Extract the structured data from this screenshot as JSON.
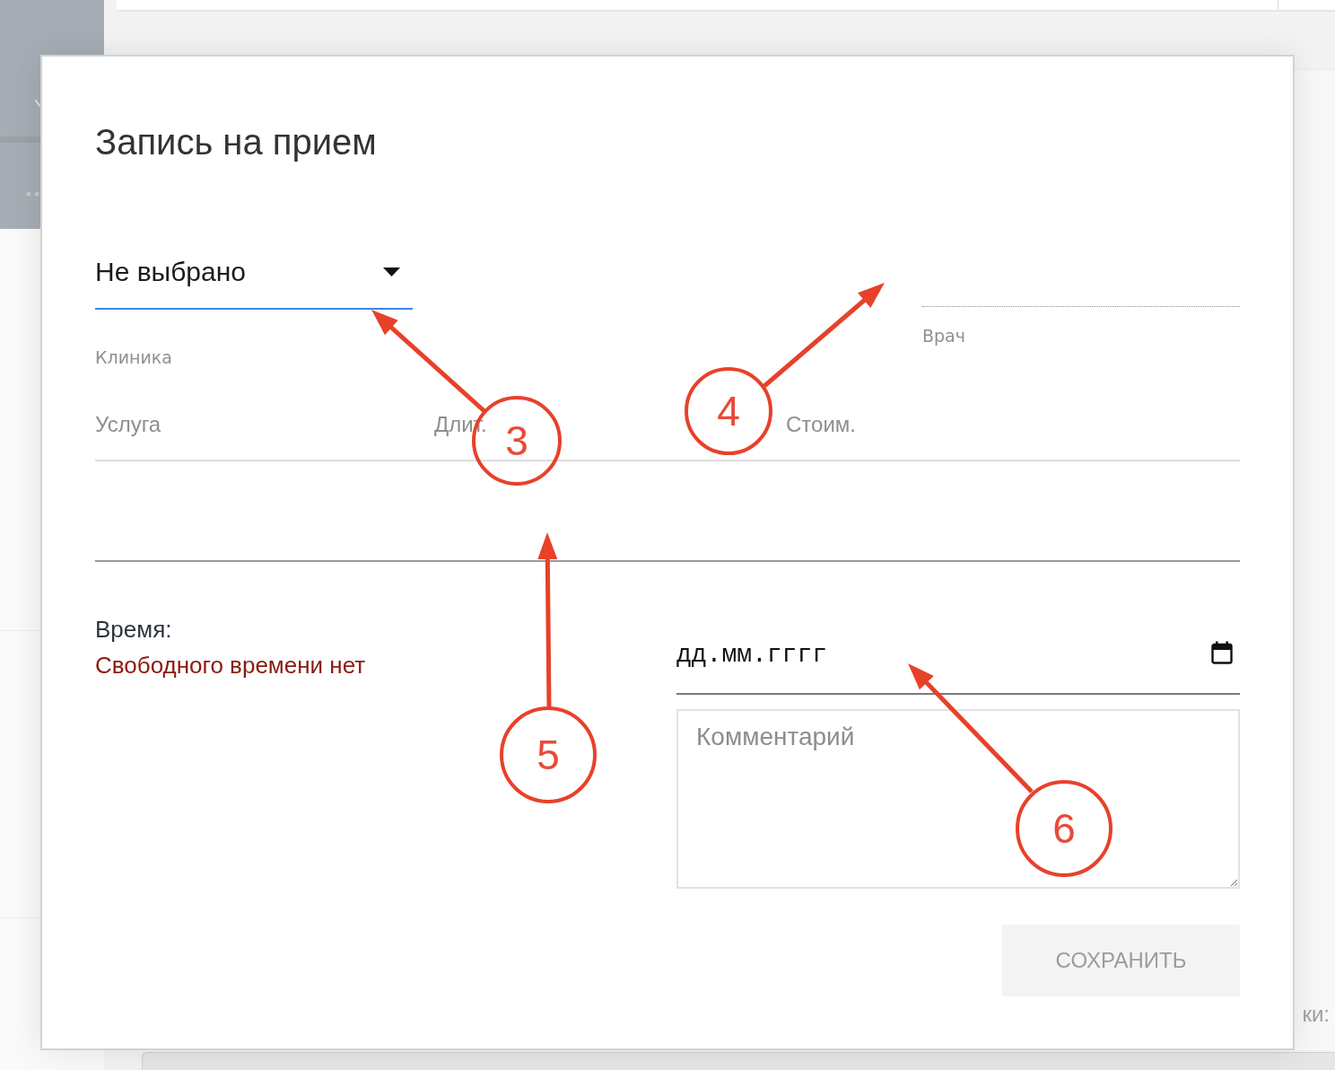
{
  "dialog": {
    "title": "Запись на прием"
  },
  "clinic": {
    "value": "Не выбрано",
    "label": "Клиника",
    "focused": true
  },
  "doctor": {
    "label": "Врач",
    "disabled": true
  },
  "services": {
    "columns": [
      "Услуга",
      "Длит.",
      "Стоим."
    ]
  },
  "time": {
    "label": "Время:",
    "message": "Свободного времени нет"
  },
  "date": {
    "placeholder": "дд.мм.гггг"
  },
  "comment": {
    "placeholder": "Комментарий"
  },
  "save_button": {
    "label": "СОХРАНИТЬ",
    "disabled": true
  },
  "annotations": [
    {
      "number": "3"
    },
    {
      "number": "4"
    },
    {
      "number": "5"
    },
    {
      "number": "6"
    }
  ],
  "background": {
    "footer_text": "ки:"
  }
}
